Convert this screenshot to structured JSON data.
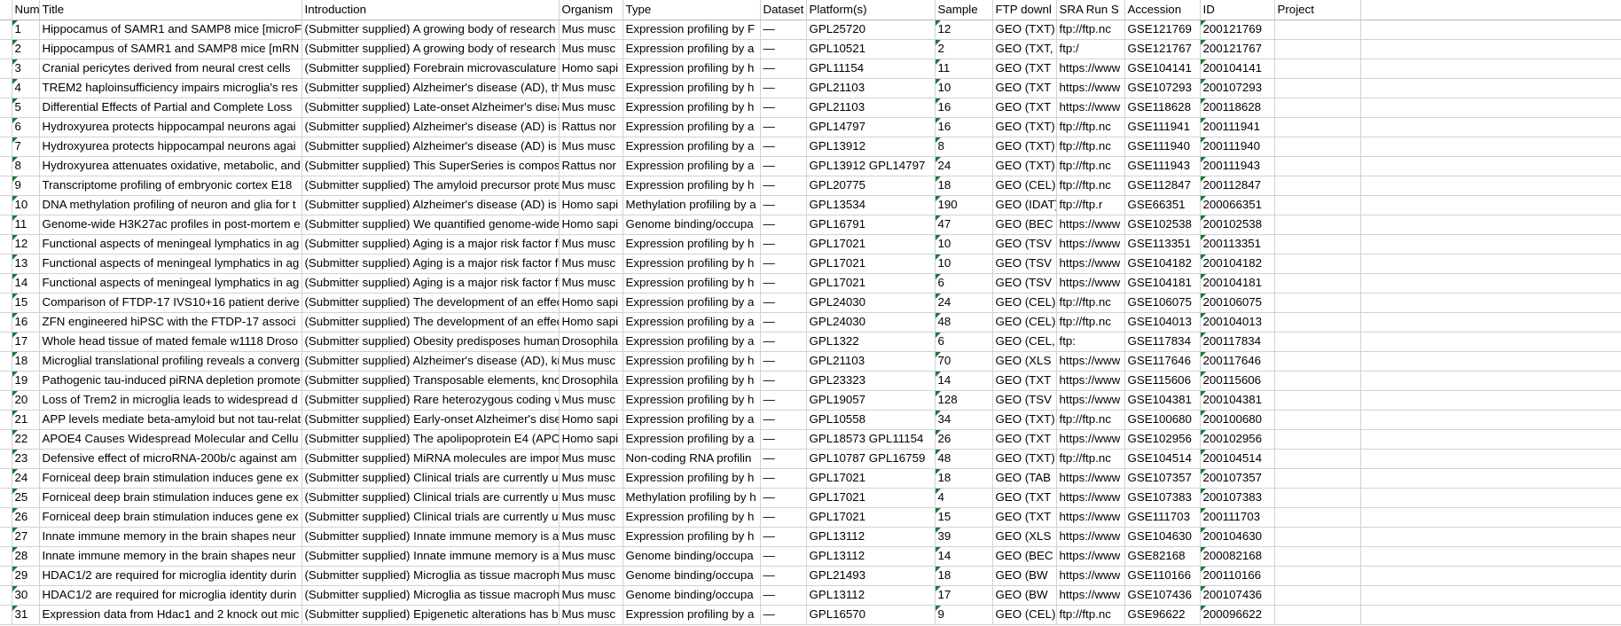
{
  "app": {
    "kind": "spreadsheet-grid",
    "grid_line_color": "#d2d2d2",
    "text_color": "#000000",
    "flag_color": "#1a7a33"
  },
  "columns": [
    {
      "key": "number",
      "label": "Numb"
    },
    {
      "key": "title",
      "label": "Title"
    },
    {
      "key": "intro",
      "label": "Introduction"
    },
    {
      "key": "organism",
      "label": "Organism"
    },
    {
      "key": "type",
      "label": "Type"
    },
    {
      "key": "dataset",
      "label": "Dataset"
    },
    {
      "key": "platform",
      "label": "Platform(s)"
    },
    {
      "key": "sample",
      "label": "Sample"
    },
    {
      "key": "ftp",
      "label": "FTP downl"
    },
    {
      "key": "sra",
      "label": "SRA Run S"
    },
    {
      "key": "accession",
      "label": "Accession"
    },
    {
      "key": "id",
      "label": "ID"
    },
    {
      "key": "project",
      "label": "Project"
    }
  ],
  "rows": [
    {
      "number": "1",
      "title": "Hippocamus of SAMR1 and SAMP8 mice [microF",
      "intro": "(Submitter supplied) A growing body of research",
      "organism": "Mus musc",
      "type": "Expression profiling by F",
      "dataset": "—",
      "platform": "GPL25720",
      "sample": "12",
      "ftp": "GEO (TXT)",
      "sra": "ftp://ftp.nc",
      "accession": "GSE121769",
      "id": "200121769",
      "project": ""
    },
    {
      "number": "2",
      "title": "Hippocampus of SAMR1 and SAMP8 mice [mRN",
      "intro": "(Submitter supplied) A growing body of research",
      "organism": "Mus musc",
      "type": "Expression profiling by a",
      "dataset": "—",
      "platform": "GPL10521",
      "sample": "2",
      "ftp": "GEO (TXT, XLS)",
      "sra": "ftp:/",
      "accession": "GSE121767",
      "id": "200121767",
      "project": ""
    },
    {
      "number": "3",
      "title": "Cranial pericytes derived from neural crest cells",
      "intro": "(Submitter supplied) Forebrain microvasculature",
      "organism": "Homo sapi",
      "type": "Expression profiling by h",
      "dataset": "—",
      "platform": "GPL11154",
      "sample": "11",
      "ftp": "GEO (TXT",
      "sra": "https://www",
      "accession": "GSE104141",
      "id": "200104141",
      "project": ""
    },
    {
      "number": "4",
      "title": "TREM2 haploinsufficiency impairs microglia's res",
      "intro": "(Submitter supplied) Alzheimer's disease (AD), th",
      "organism": "Mus musc",
      "type": "Expression profiling by h",
      "dataset": "—",
      "platform": "GPL21103",
      "sample": "10",
      "ftp": "GEO (TXT",
      "sra": "https://www",
      "accession": "GSE107293",
      "id": "200107293",
      "project": ""
    },
    {
      "number": "5",
      "title": "Differential Effects of Partial and Complete Loss",
      "intro": "(Submitter supplied) Late-onset Alzheimer's disea",
      "organism": "Mus musc",
      "type": "Expression profiling by h",
      "dataset": "—",
      "platform": "GPL21103",
      "sample": "16",
      "ftp": "GEO (TXT",
      "sra": "https://www",
      "accession": "GSE118628",
      "id": "200118628",
      "project": ""
    },
    {
      "number": "6",
      "title": "Hydroxyurea protects hippocampal neurons agai",
      "intro": "(Submitter supplied) Alzheimer's disease (AD) is",
      "organism": "Rattus nor",
      "type": "Expression profiling by a",
      "dataset": "—",
      "platform": "GPL14797",
      "sample": "16",
      "ftp": "GEO (TXT)",
      "sra": "ftp://ftp.nc",
      "accession": "GSE111941",
      "id": "200111941",
      "project": ""
    },
    {
      "number": "7",
      "title": "Hydroxyurea protects hippocampal neurons agai",
      "intro": "(Submitter supplied) Alzheimer's disease (AD) is",
      "organism": "Mus musc",
      "type": "Expression profiling by a",
      "dataset": "—",
      "platform": "GPL13912",
      "sample": "8",
      "ftp": "GEO (TXT)",
      "sra": "ftp://ftp.nc",
      "accession": "GSE111940",
      "id": "200111940",
      "project": ""
    },
    {
      "number": "8",
      "title": "Hydroxyurea attenuates oxidative, metabolic, and",
      "intro": "(Submitter supplied) This SuperSeries is compos",
      "organism": "Rattus nor",
      "type": "Expression profiling by a",
      "dataset": "—",
      "platform": "GPL13912 GPL14797",
      "sample": "24",
      "ftp": "GEO (TXT)",
      "sra": "ftp://ftp.nc",
      "accession": "GSE111943",
      "id": "200111943",
      "project": ""
    },
    {
      "number": "9",
      "title": "Transcriptome profiling of embryonic cortex E18",
      "intro": "(Submitter supplied) The amyloid precursor prote",
      "organism": "Mus musc",
      "type": "Expression profiling by h",
      "dataset": "—",
      "platform": "GPL20775",
      "sample": "18",
      "ftp": "GEO (CEL)",
      "sra": "ftp://ftp.nc",
      "accession": "GSE112847",
      "id": "200112847",
      "project": ""
    },
    {
      "number": "10",
      "title": "DNA methylation profiling of neuron and glia for t",
      "intro": "(Submitter supplied) Alzheimer's disease (AD) is",
      "organism": "Homo sapi",
      "type": "Methylation profiling by a",
      "dataset": "—",
      "platform": "GPL13534",
      "sample": "190",
      "ftp": "GEO (IDAT)",
      "sra": "ftp://ftp.r",
      "accession": "GSE66351",
      "id": "200066351",
      "project": ""
    },
    {
      "number": "11",
      "title": "Genome-wide H3K27ac profiles in post-mortem e",
      "intro": "(Submitter supplied) We quantified genome-wide",
      "organism": "Homo sapi",
      "type": "Genome binding/occupa",
      "dataset": "—",
      "platform": "GPL16791",
      "sample": "47",
      "ftp": "GEO (BEC",
      "sra": "https://www",
      "accession": "GSE102538",
      "id": "200102538",
      "project": ""
    },
    {
      "number": "12",
      "title": "Functional aspects of meningeal lymphatics in ag",
      "intro": "(Submitter supplied) Aging is a major risk factor f",
      "organism": "Mus musc",
      "type": "Expression profiling by h",
      "dataset": "—",
      "platform": "GPL17021",
      "sample": "10",
      "ftp": "GEO (TSV",
      "sra": "https://www",
      "accession": "GSE113351",
      "id": "200113351",
      "project": ""
    },
    {
      "number": "13",
      "title": "Functional aspects of meningeal lymphatics in ag",
      "intro": "(Submitter supplied) Aging is a major risk factor f",
      "organism": "Mus musc",
      "type": "Expression profiling by h",
      "dataset": "—",
      "platform": "GPL17021",
      "sample": "10",
      "ftp": "GEO (TSV",
      "sra": "https://www",
      "accession": "GSE104182",
      "id": "200104182",
      "project": ""
    },
    {
      "number": "14",
      "title": "Functional aspects of meningeal lymphatics in ag",
      "intro": "(Submitter supplied) Aging is a major risk factor f",
      "organism": "Mus musc",
      "type": "Expression profiling by h",
      "dataset": "—",
      "platform": "GPL17021",
      "sample": "6",
      "ftp": "GEO (TSV",
      "sra": "https://www",
      "accession": "GSE104181",
      "id": "200104181",
      "project": ""
    },
    {
      "number": "15",
      "title": "Comparison of FTDP-17 IVS10+16 patient derive",
      "intro": "(Submitter supplied) The development of an effec",
      "organism": "Homo sapi",
      "type": "Expression profiling by a",
      "dataset": "—",
      "platform": "GPL24030",
      "sample": "24",
      "ftp": "GEO (CEL)",
      "sra": "ftp://ftp.nc",
      "accession": "GSE106075",
      "id": "200106075",
      "project": ""
    },
    {
      "number": "16",
      "title": "ZFN engineered hiPSC with the FTDP-17 associ",
      "intro": "(Submitter supplied) The development of an effec",
      "organism": "Homo sapi",
      "type": "Expression profiling by a",
      "dataset": "—",
      "platform": "GPL24030",
      "sample": "48",
      "ftp": "GEO (CEL)",
      "sra": "ftp://ftp.nc",
      "accession": "GSE104013",
      "id": "200104013",
      "project": ""
    },
    {
      "number": "17",
      "title": "Whole head tissue of mated female w1118 Droso",
      "intro": "(Submitter supplied) Obesity predisposes humans",
      "organism": "Drosophila",
      "type": "Expression profiling by a",
      "dataset": "—",
      "platform": "GPL1322",
      "sample": "6",
      "ftp": "GEO (CEL, CHP)",
      "sra": "ftp:",
      "accession": "GSE117834",
      "id": "200117834",
      "project": ""
    },
    {
      "number": "18",
      "title": "Microglial translational profiling reveals a converg",
      "intro": "(Submitter supplied) Alzheimer's disease (AD), kno",
      "organism": "Mus musc",
      "type": "Expression profiling by h",
      "dataset": "—",
      "platform": "GPL21103",
      "sample": "70",
      "ftp": "GEO (XLS",
      "sra": "https://www",
      "accession": "GSE117646",
      "id": "200117646",
      "project": ""
    },
    {
      "number": "19",
      "title": "Pathogenic tau-induced piRNA depletion promote",
      "intro": "(Submitter supplied) Transposable elements, know",
      "organism": "Drosophila",
      "type": "Expression profiling by h",
      "dataset": "—",
      "platform": "GPL23323",
      "sample": "14",
      "ftp": "GEO (TXT",
      "sra": "https://www",
      "accession": "GSE115606",
      "id": "200115606",
      "project": ""
    },
    {
      "number": "20",
      "title": "Loss of Trem2 in microglia leads to widespread d",
      "intro": "(Submitter supplied) Rare heterozygous coding v",
      "organism": "Mus musc",
      "type": "Expression profiling by h",
      "dataset": "—",
      "platform": "GPL19057",
      "sample": "128",
      "ftp": "GEO (TSV",
      "sra": "https://www",
      "accession": "GSE104381",
      "id": "200104381",
      "project": ""
    },
    {
      "number": "21",
      "title": "APP levels mediate beta-amyloid but not tau-relat",
      "intro": "(Submitter supplied) Early-onset Alzheimer's dise",
      "organism": "Homo sapi",
      "type": "Expression profiling by a",
      "dataset": "—",
      "platform": "GPL10558",
      "sample": "34",
      "ftp": "GEO (TXT)",
      "sra": "ftp://ftp.nc",
      "accession": "GSE100680",
      "id": "200100680",
      "project": ""
    },
    {
      "number": "22",
      "title": "APOE4 Causes Widespread Molecular and Cellu",
      "intro": "(Submitter supplied) The apolipoprotein E4 (APO",
      "organism": "Homo sapi",
      "type": "Expression profiling by a",
      "dataset": "—",
      "platform": "GPL18573 GPL11154",
      "sample": "26",
      "ftp": "GEO (TXT",
      "sra": "https://www",
      "accession": "GSE102956",
      "id": "200102956",
      "project": ""
    },
    {
      "number": "23",
      "title": "Defensive effect of microRNA-200b/c against am",
      "intro": "(Submitter supplied) MiRNA molecules are import",
      "organism": "Mus musc",
      "type": "Non-coding RNA profilin",
      "dataset": "—",
      "platform": "GPL10787 GPL16759",
      "sample": "48",
      "ftp": "GEO (TXT)",
      "sra": "ftp://ftp.nc",
      "accession": "GSE104514",
      "id": "200104514",
      "project": ""
    },
    {
      "number": "24",
      "title": "Forniceal deep brain stimulation induces gene ex",
      "intro": "(Submitter supplied) Clinical trials are currently u",
      "organism": "Mus musc",
      "type": "Expression profiling by h",
      "dataset": "—",
      "platform": "GPL17021",
      "sample": "18",
      "ftp": "GEO (TAB",
      "sra": "https://www",
      "accession": "GSE107357",
      "id": "200107357",
      "project": ""
    },
    {
      "number": "25",
      "title": "Forniceal deep brain stimulation induces gene ex",
      "intro": "(Submitter supplied) Clinical trials are currently u",
      "organism": "Mus musc",
      "type": "Methylation profiling by h",
      "dataset": "—",
      "platform": "GPL17021",
      "sample": "4",
      "ftp": "GEO (TXT",
      "sra": "https://www",
      "accession": "GSE107383",
      "id": "200107383",
      "project": ""
    },
    {
      "number": "26",
      "title": "Forniceal deep brain stimulation induces gene ex",
      "intro": "(Submitter supplied) Clinical trials are currently u",
      "organism": "Mus musc",
      "type": "Expression profiling by h",
      "dataset": "—",
      "platform": "GPL17021",
      "sample": "15",
      "ftp": "GEO (TXT",
      "sra": "https://www",
      "accession": "GSE111703",
      "id": "200111703",
      "project": ""
    },
    {
      "number": "27",
      "title": "Innate immune memory in the brain shapes neur",
      "intro": "(Submitter supplied) Innate immune memory is a",
      "organism": "Mus musc",
      "type": "Expression profiling by h",
      "dataset": "—",
      "platform": "GPL13112",
      "sample": "39",
      "ftp": "GEO (XLS",
      "sra": "https://www",
      "accession": "GSE104630",
      "id": "200104630",
      "project": ""
    },
    {
      "number": "28",
      "title": "Innate immune memory in the brain shapes neur",
      "intro": "(Submitter supplied) Innate immune memory is a",
      "organism": "Mus musc",
      "type": "Genome binding/occupa",
      "dataset": "—",
      "platform": "GPL13112",
      "sample": "14",
      "ftp": "GEO (BEC",
      "sra": "https://www",
      "accession": "GSE82168",
      "id": "200082168",
      "project": ""
    },
    {
      "number": "29",
      "title": "HDAC1/2 are required for microglia identity durin",
      "intro": "(Submitter supplied) Microglia as tissue macroph",
      "organism": "Mus musc",
      "type": "Genome binding/occupa",
      "dataset": "—",
      "platform": "GPL21493",
      "sample": "18",
      "ftp": "GEO (BW",
      "sra": "https://www",
      "accession": "GSE110166",
      "id": "200110166",
      "project": ""
    },
    {
      "number": "30",
      "title": "HDAC1/2 are required for microglia identity durin",
      "intro": "(Submitter supplied) Microglia as tissue macroph",
      "organism": "Mus musc",
      "type": "Genome binding/occupa",
      "dataset": "—",
      "platform": "GPL13112",
      "sample": "17",
      "ftp": "GEO (BW",
      "sra": "https://www",
      "accession": "GSE107436",
      "id": "200107436",
      "project": ""
    },
    {
      "number": "31",
      "title": "Expression data from Hdac1 and 2 knock out mic",
      "intro": "(Submitter supplied) Epigenetic alterations has be",
      "organism": "Mus musc",
      "type": "Expression profiling by a",
      "dataset": "—",
      "platform": "GPL16570",
      "sample": "9",
      "ftp": "GEO (CEL)",
      "sra": "ftp://ftp.nc",
      "accession": "GSE96622",
      "id": "200096622",
      "project": ""
    }
  ]
}
